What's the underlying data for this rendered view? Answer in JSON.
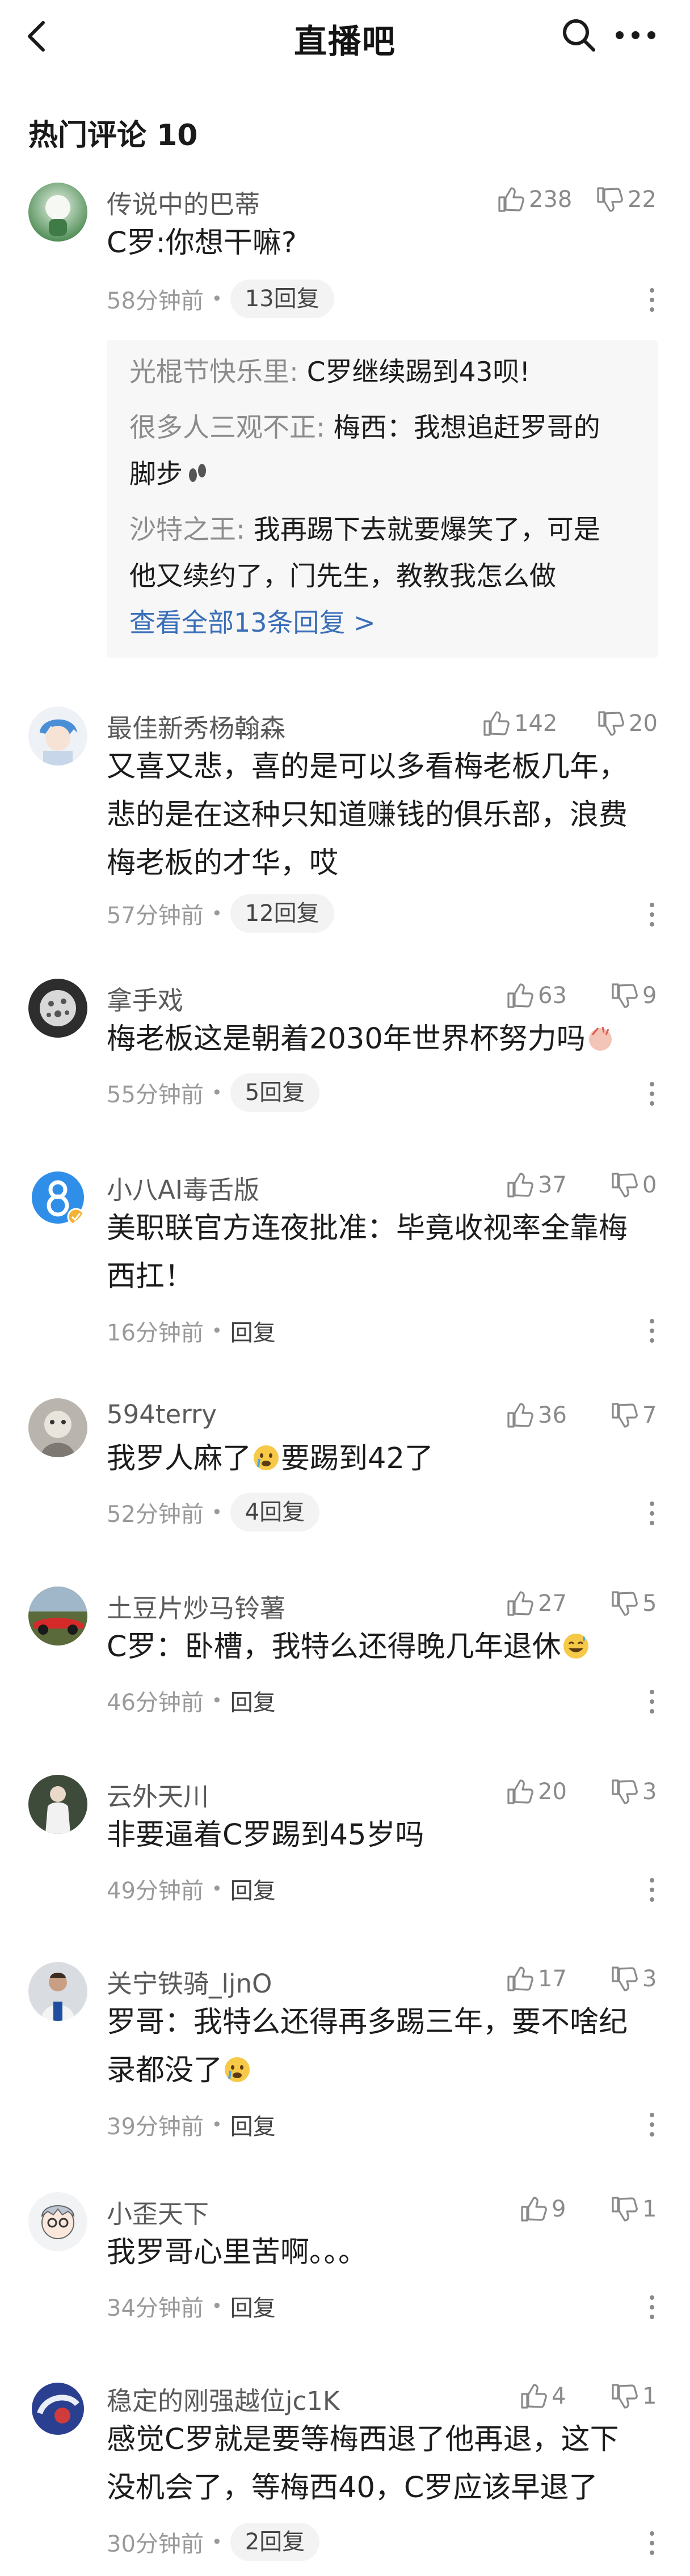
{
  "header": {
    "title": "直播吧"
  },
  "section": {
    "title": "热门评论 10"
  },
  "comments": [
    {
      "username": "传说中的巴蒂",
      "likes": "238",
      "dislikes": "22",
      "lines": [
        "C罗:你想干嘛?"
      ],
      "time": "58分钟前",
      "replies": "13回复",
      "thread": [
        {
          "name": "光棍节快乐里:",
          "text": " C罗继续踢到43呗!"
        },
        {
          "name": "很多人三观不正:",
          "text": " 梅西：我想追赶罗哥的"
        },
        {
          "name": "",
          "text": "脚步"
        },
        {
          "name": "沙特之王:",
          "text": " 我再踢下去就要爆笑了，可是"
        },
        {
          "name": "",
          "text": "他又续约了，门先生，教教我怎么做"
        }
      ],
      "thread_more": "查看全部13条回复 >"
    },
    {
      "username": "最佳新秀杨翰森",
      "likes": "142",
      "dislikes": "20",
      "lines": [
        "又喜又悲，喜的是可以多看梅老板几年，",
        "悲的是在这种只知道赚钱的俱乐部，浪费",
        "梅老板的才华，哎"
      ],
      "time": "57分钟前",
      "replies": "12回复"
    },
    {
      "username": "拿手戏",
      "likes": "63",
      "dislikes": "9",
      "lines": [
        "梅老板这是朝着2030年世界杯努力吗"
      ],
      "time": "55分钟前",
      "replies": "5回复"
    },
    {
      "username": "小八AI毒舌版",
      "likes": "37",
      "dislikes": "0",
      "lines": [
        "美职联官方连夜批准：毕竟收视率全靠梅",
        "西扛！"
      ],
      "time": "16分钟前",
      "replies": "回复"
    },
    {
      "username": "594terry",
      "likes": "36",
      "dislikes": "7",
      "lines": [
        "我罗人麻了",
        "要踢到42了"
      ],
      "time": "52分钟前",
      "replies": "4回复"
    },
    {
      "username": "土豆片炒马铃薯",
      "likes": "27",
      "dislikes": "5",
      "lines": [
        "C罗：卧槽，我特么还得晚几年退休"
      ],
      "time": "46分钟前",
      "replies": "回复"
    },
    {
      "username": "云外天川",
      "likes": "20",
      "dislikes": "3",
      "lines": [
        "非要逼着C罗踢到45岁吗"
      ],
      "time": "49分钟前",
      "replies": "回复"
    },
    {
      "username": "关宁铁骑_ljnO",
      "likes": "17",
      "dislikes": "3",
      "lines": [
        "罗哥：我特么还得再多踢三年，要不啥纪",
        "录都没了"
      ],
      "time": "39分钟前",
      "replies": "回复"
    },
    {
      "username": "小歪天下",
      "likes": "9",
      "dislikes": "1",
      "lines": [
        "我罗哥心里苦啊。。。"
      ],
      "time": "34分钟前",
      "replies": "回复"
    },
    {
      "username": "稳定的刚强越位jc1K",
      "likes": "4",
      "dislikes": "1",
      "lines": [
        "感觉C罗就是要等梅西退了他再退，这下",
        "没机会了，等梅西40，C罗应该早退了"
      ],
      "time": "30分钟前",
      "replies": "2回复"
    }
  ],
  "colors": {
    "link": "#3a6fb8",
    "muted": "#9a9a9a",
    "reply_bg": "#f7f7f7"
  },
  "icons": [
    "back-arrow-icon",
    "search-icon",
    "more-icon",
    "thumb-up-icon",
    "thumb-down-icon",
    "kebab-icon"
  ]
}
